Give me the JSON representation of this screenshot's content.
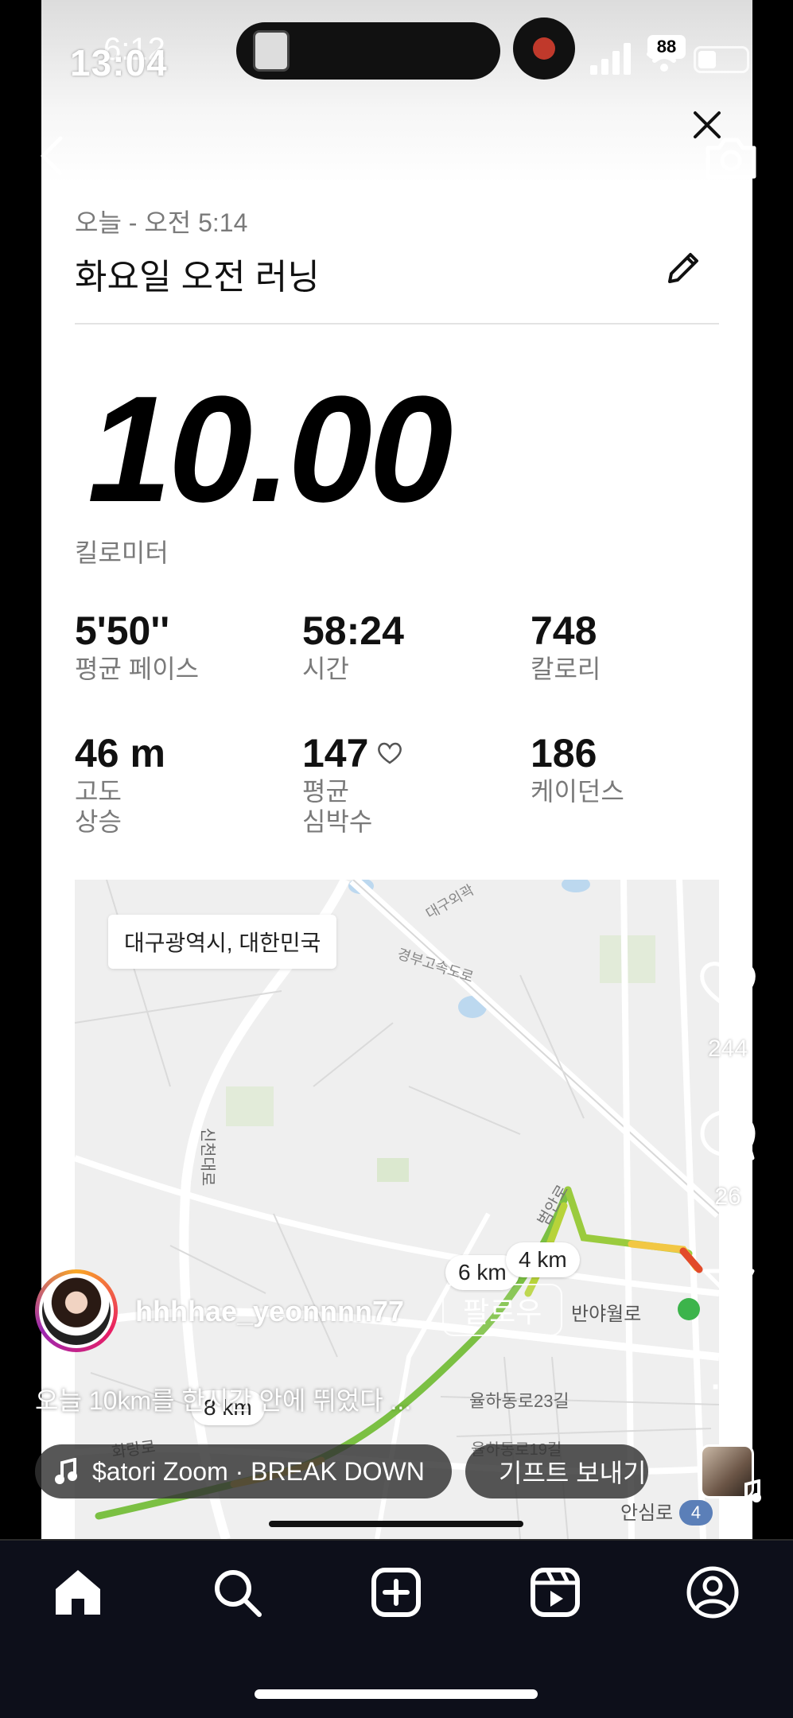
{
  "status": {
    "outer_time": "13:04",
    "inner_time": "6:12",
    "battery": "88"
  },
  "card": {
    "date": "오늘 - 오전 5:14",
    "title": "화요일 오전 러닝",
    "distance": "10.00",
    "distance_unit": "킬로미터",
    "stats": [
      {
        "value": "5'50''",
        "label": "평균 페이스"
      },
      {
        "value": "58:24",
        "label": "시간"
      },
      {
        "value": "748",
        "label": "칼로리"
      },
      {
        "value": "46 m",
        "label": "고도\n상승"
      },
      {
        "value": "147",
        "label": "평균\n심박수"
      },
      {
        "value": "186",
        "label": "케이던스"
      }
    ]
  },
  "map": {
    "location": "대구광역시, 대한민국",
    "km_markers": [
      "6 km",
      "4 km",
      "8 km"
    ],
    "road_labels": [
      "신천대로",
      "경부고속도로",
      "반야월로",
      "율하동로23길",
      "율하동로19길",
      "안심로",
      "범안로",
      "대구외곽",
      "화랑로",
      "4"
    ]
  },
  "instagram": {
    "username": "hhhhae_yeonnnn77",
    "follow_label": "팔로우",
    "caption": "오늘 10km를 한시간 안에 뛰었다 ...",
    "music": "$atori Zoom · BREAK DOWN",
    "gift": "기프트 보내기",
    "likes": "244",
    "comments": "26"
  },
  "colors": {
    "route_green": "#7bc043",
    "route_yellow": "#f2c744",
    "route_red": "#e24b2a",
    "nav_bg": "#0d0f1a"
  }
}
